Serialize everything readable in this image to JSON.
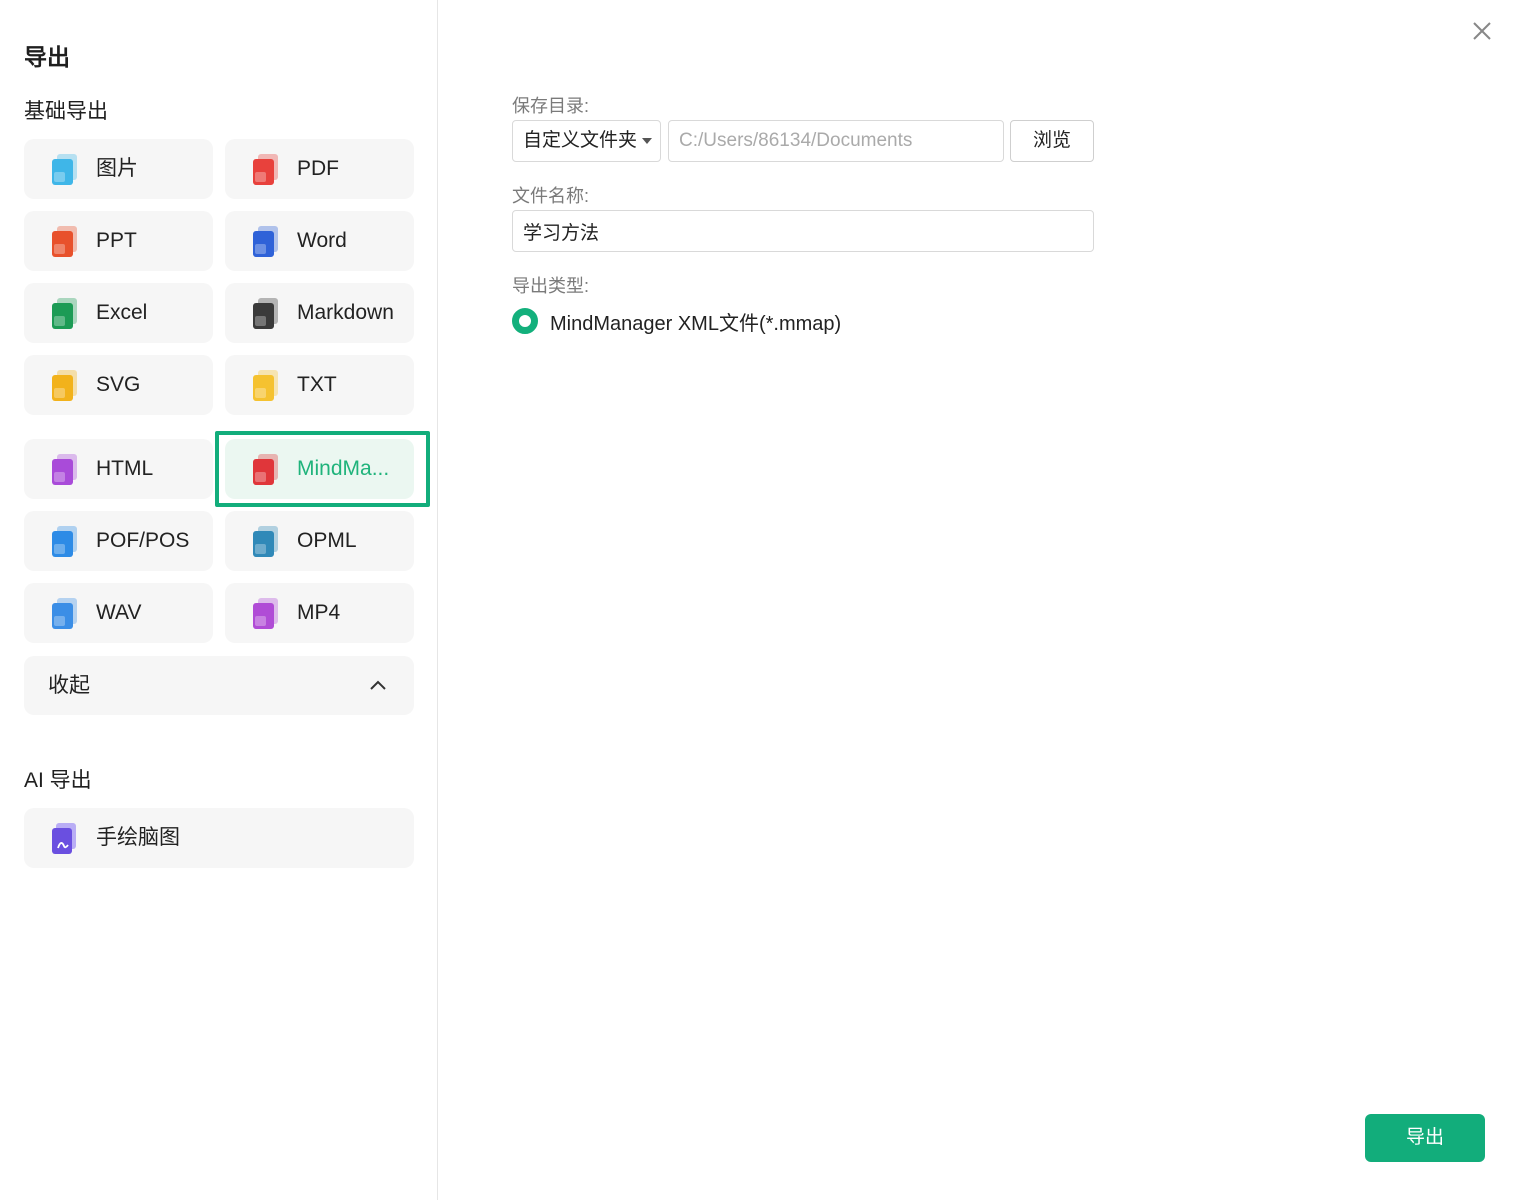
{
  "sidebar": {
    "title": "导出",
    "basic_section": "基础导出",
    "formats": [
      {
        "label": "图片",
        "icon": "image-file-icon",
        "color": "#3fb6e8"
      },
      {
        "label": "PDF",
        "icon": "pdf-file-icon",
        "color": "#e8413c"
      },
      {
        "label": "PPT",
        "icon": "ppt-file-icon",
        "color": "#e8512c"
      },
      {
        "label": "Word",
        "icon": "word-file-icon",
        "color": "#2f62d8"
      },
      {
        "label": "Excel",
        "icon": "excel-file-icon",
        "color": "#1c9b55"
      },
      {
        "label": "Markdown",
        "icon": "markdown-file-icon",
        "color": "#3a3a3a"
      },
      {
        "label": "SVG",
        "icon": "svg-file-icon",
        "color": "#f2b21b"
      },
      {
        "label": "TXT",
        "icon": "txt-file-icon",
        "color": "#f5c230"
      },
      {
        "label": "HTML",
        "icon": "html-file-icon",
        "color": "#a94bd9"
      },
      {
        "label": "MindMa...",
        "icon": "mindmanager-file-icon",
        "color": "#e0363a",
        "selected": true
      },
      {
        "label": "POF/POS",
        "icon": "pof-file-icon",
        "color": "#2d8be6"
      },
      {
        "label": "OPML",
        "icon": "opml-file-icon",
        "color": "#3089b8"
      },
      {
        "label": "WAV",
        "icon": "wav-file-icon",
        "color": "#3b8ee6"
      },
      {
        "label": "MP4",
        "icon": "mp4-file-icon",
        "color": "#b04cd6"
      }
    ],
    "collapse_label": "收起",
    "ai_section": "AI 导出",
    "ai_item": {
      "label": "手绘脑图",
      "icon": "hand-drawn-mindmap-icon",
      "color": "#6a4fe0"
    }
  },
  "form": {
    "save_dir_label": "保存目录:",
    "dir_select_value": "自定义文件夹",
    "dir_path_placeholder": "C:/Users/86134/Documents",
    "browse_label": "浏览",
    "filename_label": "文件名称:",
    "filename_value": "学习方法",
    "type_label": "导出类型:",
    "type_option": "MindManager XML文件(*.mmap)"
  },
  "export_button": "导出",
  "accent_color": "#12ad7b"
}
